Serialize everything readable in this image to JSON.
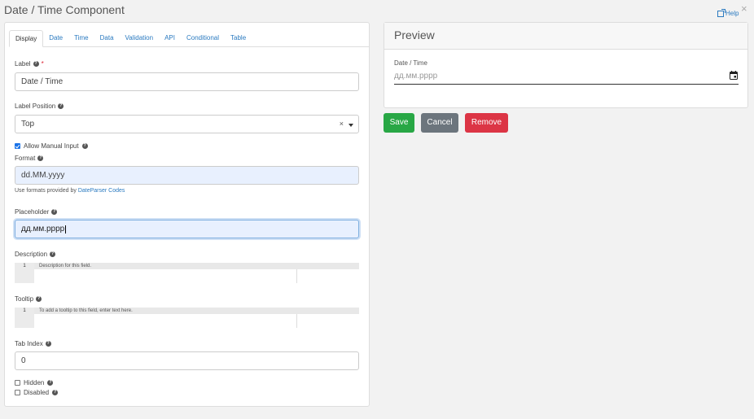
{
  "header": {
    "title": "Date / Time Component",
    "help": "Help",
    "close": "×"
  },
  "tabs": [
    {
      "label": "Display",
      "active": true
    },
    {
      "label": "Date"
    },
    {
      "label": "Time"
    },
    {
      "label": "Data"
    },
    {
      "label": "Validation"
    },
    {
      "label": "API"
    },
    {
      "label": "Conditional"
    },
    {
      "label": "Table"
    }
  ],
  "form": {
    "label_label": "Label",
    "label_required": "*",
    "label_value": "Date / Time",
    "label_position_label": "Label Position",
    "label_position_value": "Top",
    "label_position_clear": "×",
    "allow_manual_label": "Allow Manual Input",
    "allow_manual_checked": true,
    "format_label": "Format",
    "format_value": "dd.MM.yyyy",
    "format_hint": "Use formats provided by",
    "format_hint_link": "DateParser Codes",
    "placeholder_label": "Placeholder",
    "placeholder_value": "дд.мм.рррр",
    "description_label": "Description",
    "description_line_no": "1",
    "description_text": "Description for this field.",
    "tooltip_label": "Tooltip",
    "tooltip_line_no": "1",
    "tooltip_text": "To add a tooltip to this field, enter text here.",
    "tab_index_label": "Tab Index",
    "tab_index_value": "0",
    "hidden_label": "Hidden",
    "disabled_label": "Disabled"
  },
  "preview": {
    "title": "Preview",
    "field_label": "Date / Time",
    "field_placeholder": "дд.мм.рррр"
  },
  "buttons": {
    "save": "Save",
    "cancel": "Cancel",
    "remove": "Remove"
  },
  "colors": {
    "save": "#28a745",
    "cancel": "#6c757d",
    "remove": "#dc3545",
    "link": "#2a7ac0"
  }
}
